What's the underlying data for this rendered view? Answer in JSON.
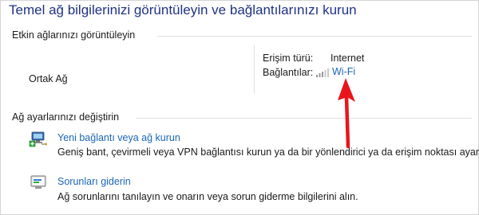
{
  "page": {
    "title": "Temel ağ bilgilerinizi görüntüleyin ve bağlantılarınızı kurun"
  },
  "active_networks": {
    "header": "Etkin ağlarınızı görüntüleyin",
    "network_name": "Ortak Ağ",
    "access_type_label": "Erişim türü:",
    "access_type_value": "Internet",
    "connections_label": "Bağlantılar:",
    "connection_link": "Wi-Fi",
    "connection_icon": "wifi-signal-icon"
  },
  "change_settings": {
    "header": "Ağ ayarlarınızı değiştirin",
    "tasks": [
      {
        "icon": "new-connection-icon",
        "title": "Yeni bağlantı veya ağ kurun",
        "description": "Geniş bant, çevirmeli veya VPN bağlantısı kurun ya da bir yönlendirici ya da erişim noktası ayarlayın."
      },
      {
        "icon": "troubleshoot-icon",
        "title": "Sorunları giderin",
        "description": "Ağ sorunlarını tanılayın ve onarın veya sorun giderme bilgilerini alın."
      }
    ]
  },
  "colors": {
    "title": "#1e3287",
    "link": "#1a66b5",
    "annotation_arrow": "#e8151d"
  }
}
